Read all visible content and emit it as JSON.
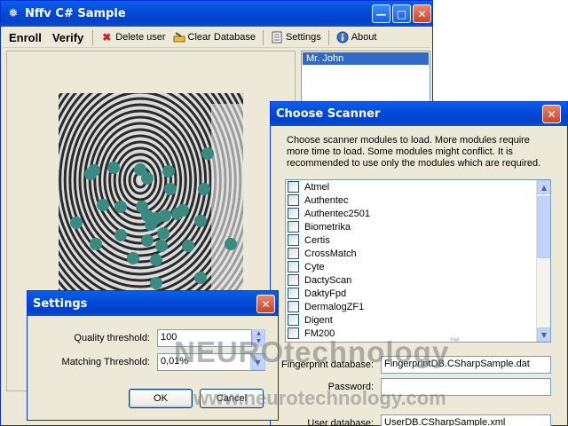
{
  "main_window": {
    "title": "Nffv C# Sample",
    "toolbar": {
      "enroll": "Enroll",
      "verify": "Verify",
      "delete_user": "Delete user",
      "clear_database": "Clear Database",
      "settings": "Settings",
      "about": "About"
    },
    "users": [
      "Mr. John"
    ]
  },
  "scanner_dialog": {
    "title": "Choose Scanner",
    "description": "Choose scanner modules to load. More modules require more time to load. Some modules might conflict. It is recommended to use only the modules which are required.",
    "modules": [
      "Atmel",
      "Authentec",
      "Authentec2501",
      "Biometrika",
      "Certis",
      "CrossMatch",
      "Cyte",
      "DactyScan",
      "DaktyFpd",
      "DermalogZF1",
      "Digent",
      "FM200"
    ],
    "fingerprint_db_label": "Fingerprint database:",
    "fingerprint_db_value": "FingerprintDB.CSharpSample.dat",
    "password_label": "Password:",
    "password_value": "",
    "user_db_label": "User database:",
    "user_db_value": "UserDB.CSharpSample.xml"
  },
  "settings_dialog": {
    "title": "Settings",
    "quality_label": "Quality threshold:",
    "quality_value": "100",
    "matching_label": "Matching Threshold:",
    "matching_value": "0,01%",
    "ok_label": "OK",
    "cancel_label": "Cancel"
  },
  "watermark": {
    "brand_a": "NEURO",
    "brand_b": "technology",
    "url": "www.neurotechnology.com"
  },
  "colors": {
    "titlebar": "#0349d8",
    "minutiae": "#3a8a80",
    "selection": "#316ac5"
  }
}
